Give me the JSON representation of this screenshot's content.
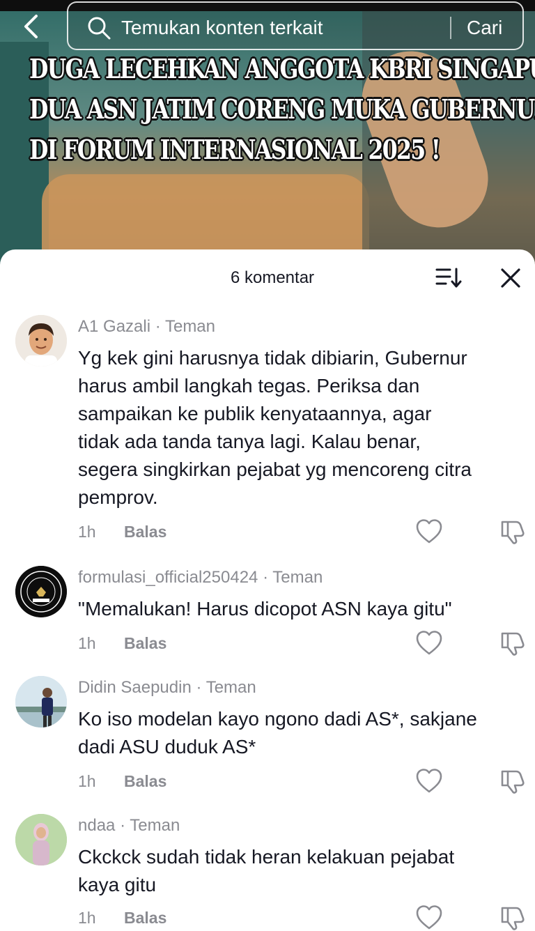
{
  "search": {
    "placeholder": "Temukan konten terkait",
    "button_label": "Cari"
  },
  "video": {
    "headline_lines": [
      "DUGA LECEHKAN ANGGOTA KBRI SINGAPURA,",
      "DUA ASN JATIM CORENG MUKA GUBERNUR",
      "DI FORUM INTERNASIONAL 2025 !"
    ]
  },
  "comments_panel": {
    "count_label": "6 komentar",
    "sort_icon": "sort-icon",
    "close_icon": "close-icon",
    "comments": [
      {
        "username": "A1 Gazali",
        "relation": "Teman",
        "text_lines": [
          "Yg kek gini harusnya tidak dibiarin, Gubernur",
          "harus ambil langkah tegas. Periksa dan",
          "sampaikan ke publik kenyataannya, agar",
          "tidak ada tanda tanya lagi. Kalau benar,",
          "segera singkirkan pejabat yg mencoreng citra",
          "pemprov."
        ],
        "time": "1h",
        "reply_label": "Balas"
      },
      {
        "username": "formulasi_official250424",
        "relation": "Teman",
        "text_lines": [
          "\"Memalukan! Harus dicopot ASN kaya gitu\""
        ],
        "time": "1h",
        "reply_label": "Balas"
      },
      {
        "username": "Didin Saepudin",
        "relation": "Teman",
        "text_lines": [
          "Ko iso modelan kayo ngono dadi AS*, sakjane",
          "dadi ASU duduk AS*"
        ],
        "time": "1h",
        "reply_label": "Balas"
      },
      {
        "username": "ndaa",
        "relation": "Teman",
        "text_lines": [
          "Ckckck sudah tidak heran kelakuan pejabat",
          "kaya gitu"
        ],
        "time": "1h",
        "reply_label": "Balas"
      }
    ]
  }
}
